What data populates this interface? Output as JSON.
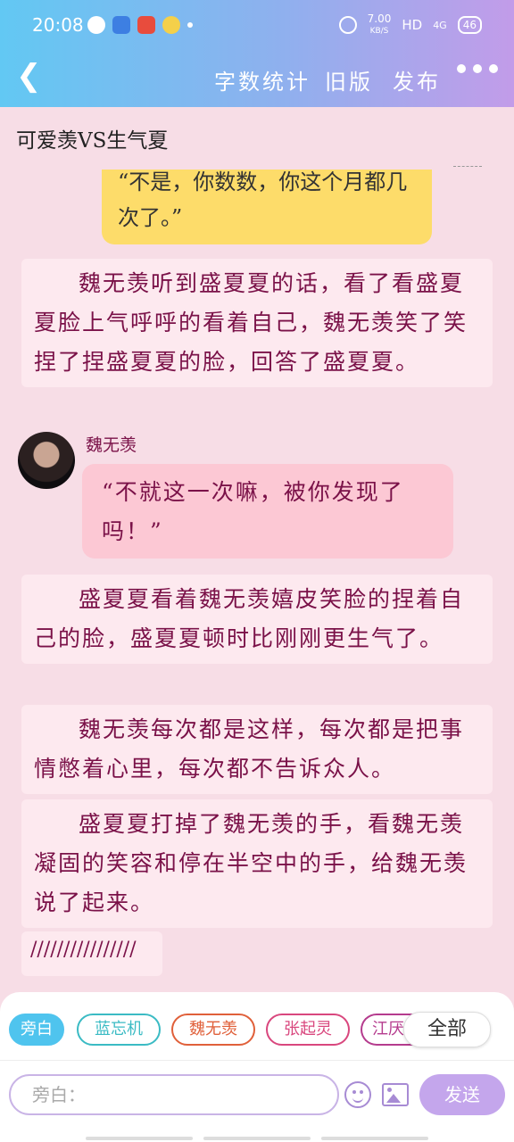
{
  "status_bar": {
    "time": "20:08",
    "speed": "7.00",
    "speed_unit": "KB/S",
    "network": "HD",
    "signal": "4G",
    "battery": "46"
  },
  "nav": {
    "word_count": "字数统计",
    "old_version": "旧版",
    "publish": "发布"
  },
  "story_title": "可爱羡VS生气夏",
  "messages": {
    "yellow_bubble": "“不是，你数数，你这个月都几次了。”",
    "narration_1": "魏无羡听到盛夏夏的话，看了看盛夏夏脸上气呼呼的看着自己，魏无羡笑了笑捏了捏盛夏夏的脸，回答了盛夏夏。",
    "speaker_name": "魏无羡",
    "speaker_bubble": "“不就这一次嘛，被你发现了吗！”",
    "narration_2": "盛夏夏看着魏无羡嬉皮笑脸的捏着自己的脸，盛夏夏顿时比刚刚更生气了。",
    "narration_3": "魏无羡每次都是这样，每次都是把事情憋着心里，每次都不告诉众人。",
    "narration_4": "盛夏夏打掉了魏无羡的手，看魏无羡凝固的笑容和停在半空中的手，给魏无羡说了起来。",
    "slashes": "////////////////"
  },
  "roles": [
    {
      "label": "旁白",
      "color": "#4fc4ee"
    },
    {
      "label": "蓝忘机",
      "color": "#3bbbc4"
    },
    {
      "label": "魏无羡",
      "color": "#e0603a"
    },
    {
      "label": "张起灵",
      "color": "#d9477e"
    },
    {
      "label": "江厌",
      "color": "#b53c8e"
    }
  ],
  "all_label": "全部",
  "input_placeholder": "旁白：",
  "send_label": "发送"
}
